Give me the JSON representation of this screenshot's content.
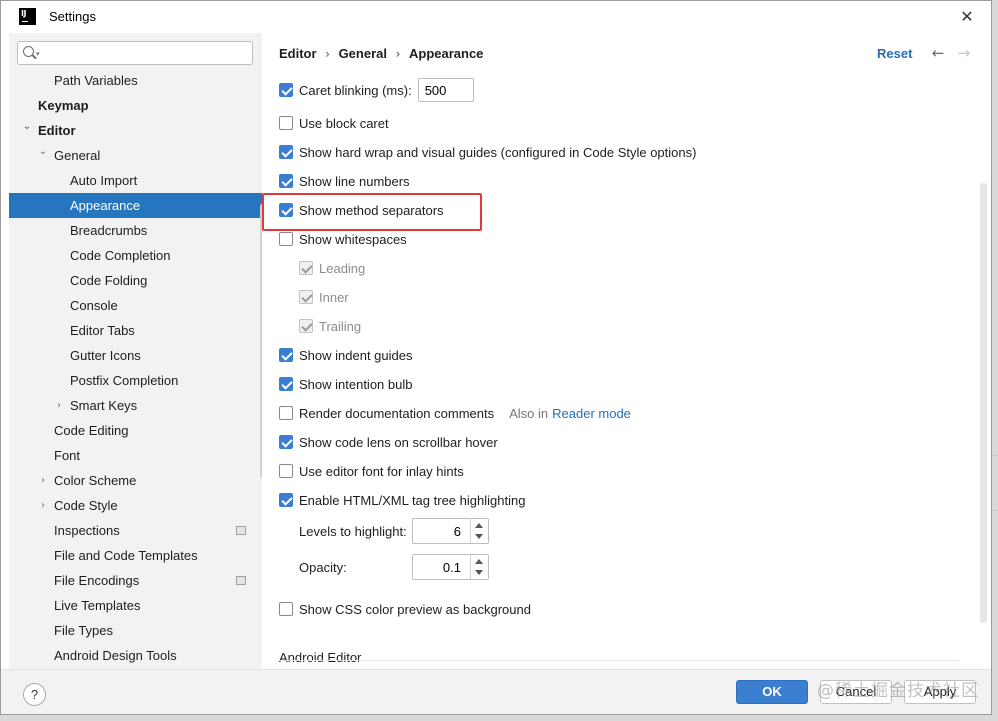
{
  "window": {
    "title": "Settings",
    "app_icon_text": "IJ"
  },
  "search": {
    "value": "",
    "placeholder": ""
  },
  "sidebar": {
    "items": [
      {
        "label": "Path Variables",
        "level": 2,
        "bold": false,
        "arrow": ""
      },
      {
        "label": "Keymap",
        "level": 1,
        "bold": true,
        "arrow": ""
      },
      {
        "label": "Editor",
        "level": 1,
        "bold": true,
        "arrow": "down"
      },
      {
        "label": "General",
        "level": 2,
        "bold": false,
        "arrow": "down"
      },
      {
        "label": "Auto Import",
        "level": 3,
        "bold": false,
        "arrow": ""
      },
      {
        "label": "Appearance",
        "level": 3,
        "bold": false,
        "arrow": "",
        "selected": true
      },
      {
        "label": "Breadcrumbs",
        "level": 3,
        "bold": false,
        "arrow": ""
      },
      {
        "label": "Code Completion",
        "level": 3,
        "bold": false,
        "arrow": ""
      },
      {
        "label": "Code Folding",
        "level": 3,
        "bold": false,
        "arrow": ""
      },
      {
        "label": "Console",
        "level": 3,
        "bold": false,
        "arrow": ""
      },
      {
        "label": "Editor Tabs",
        "level": 3,
        "bold": false,
        "arrow": ""
      },
      {
        "label": "Gutter Icons",
        "level": 3,
        "bold": false,
        "arrow": ""
      },
      {
        "label": "Postfix Completion",
        "level": 3,
        "bold": false,
        "arrow": ""
      },
      {
        "label": "Smart Keys",
        "level": 3,
        "bold": false,
        "arrow": "right"
      },
      {
        "label": "Code Editing",
        "level": 2,
        "bold": false,
        "arrow": ""
      },
      {
        "label": "Font",
        "level": 2,
        "bold": false,
        "arrow": ""
      },
      {
        "label": "Color Scheme",
        "level": 2,
        "bold": false,
        "arrow": "right"
      },
      {
        "label": "Code Style",
        "level": 2,
        "bold": false,
        "arrow": "right"
      },
      {
        "label": "Inspections",
        "level": 2,
        "bold": false,
        "arrow": "",
        "badge": true
      },
      {
        "label": "File and Code Templates",
        "level": 2,
        "bold": false,
        "arrow": ""
      },
      {
        "label": "File Encodings",
        "level": 2,
        "bold": false,
        "arrow": "",
        "badge": true
      },
      {
        "label": "Live Templates",
        "level": 2,
        "bold": false,
        "arrow": ""
      },
      {
        "label": "File Types",
        "level": 2,
        "bold": false,
        "arrow": ""
      },
      {
        "label": "Android Design Tools",
        "level": 2,
        "bold": false,
        "arrow": ""
      }
    ]
  },
  "header": {
    "breadcrumb": [
      "Editor",
      "General",
      "Appearance"
    ],
    "separator": "›",
    "reset_label": "Reset",
    "back_icon": "←",
    "forward_icon": "→"
  },
  "options": {
    "caret_blinking": {
      "label": "Caret blinking (ms):",
      "checked": true,
      "value": "500"
    },
    "block_caret": {
      "label": "Use block caret",
      "checked": false
    },
    "hard_wrap": {
      "label": "Show hard wrap and visual guides (configured in Code Style options)",
      "checked": true
    },
    "line_numbers": {
      "label": "Show line numbers",
      "checked": true
    },
    "method_separators": {
      "label": "Show method separators",
      "checked": true
    },
    "whitespaces": {
      "label": "Show whitespaces",
      "checked": false
    },
    "leading": {
      "label": "Leading",
      "checked": true,
      "disabled": true
    },
    "inner": {
      "label": "Inner",
      "checked": true,
      "disabled": true
    },
    "trailing": {
      "label": "Trailing",
      "checked": true,
      "disabled": true
    },
    "indent_guides": {
      "label": "Show indent guides",
      "checked": true
    },
    "intention_bulb": {
      "label": "Show intention bulb",
      "checked": true
    },
    "render_docs": {
      "label": "Render documentation comments",
      "checked": false,
      "also_text": "Also in",
      "also_link": "Reader mode"
    },
    "code_lens": {
      "label": "Show code lens on scrollbar hover",
      "checked": true
    },
    "inlay_font": {
      "label": "Use editor font for inlay hints",
      "checked": false
    },
    "tag_tree": {
      "label": "Enable HTML/XML tag tree highlighting",
      "checked": true
    },
    "levels": {
      "label": "Levels to highlight:",
      "value": "6"
    },
    "opacity": {
      "label": "Opacity:",
      "value": "0.1"
    },
    "css_color": {
      "label": "Show CSS color preview as background",
      "checked": false
    }
  },
  "section": {
    "android_editor": "Android Editor"
  },
  "footer": {
    "help_label": "?",
    "ok_label": "OK",
    "cancel_label": "Cancel",
    "apply_label": "Apply"
  },
  "watermark": "@稀土掘金技术社区",
  "colors": {
    "accent": "#3a7fd0",
    "selection": "#2675bf",
    "highlight_box": "#e23a3a",
    "link": "#2470b3"
  }
}
